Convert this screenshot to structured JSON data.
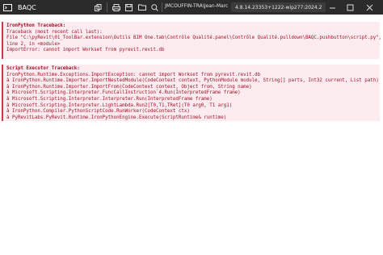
{
  "window": {
    "title": "BAQC",
    "user": "JMCOUFFIN-TRA\\Jean-Marc",
    "version": "4.8.14.23353+1222-wip277:2024.2",
    "toolbar_icons": [
      "terminal-icon",
      "copy-icon",
      "lock-icon",
      "print-icon",
      "save-icon",
      "open-folder-icon",
      "search-icon"
    ],
    "window_controls": [
      "minimize-icon",
      "maximize-icon",
      "close-icon"
    ]
  },
  "traceback": {
    "header": "IronPython Traceback:",
    "lines": [
      "Traceback (most recent call last):",
      "File \"C:\\pyRevit\\01_ToolBar.extension\\Outils BIM One.tab\\Contrôle Qualité.panel\\Contrôle Qualité.pulldown\\BAQC.pushbutton\\script.py\",",
      "line 2, in <module>",
      "ImportError: cannot import Workset from pyrevit.revit.db"
    ]
  },
  "executor": {
    "header": "Script Executor Traceback:",
    "lines": [
      "IronPython.Runtime.Exceptions.ImportException: cannot import Workset from pyrevit.revit.db",
      "à IronPython.Runtime.Importer.ImportNestedModule(CodeContext context, PythonModule module, String[] parts, Int32 current, List path)",
      "à IronPython.Runtime.Importer.ImportFrom(CodeContext context, Object from, String name)",
      "à Microsoft.Scripting.Interpreter.FuncCallInstruction`4.Run(InterpretedFrame frame)",
      "à Microsoft.Scripting.Interpreter.Interpreter.Run(InterpretedFrame frame)",
      "à Microsoft.Scripting.Interpreter.LightLambda.Run2[T0,T1,TRet](T0 arg0, T1 arg1)",
      "à IronPython.Compiler.PythonScriptCode.RunWorker(CodeContext ctx)",
      "à PyRevitLabs.PyRevit.Runtime.IronPythonEngine.Execute(ScriptRuntime& runtime)"
    ]
  }
}
